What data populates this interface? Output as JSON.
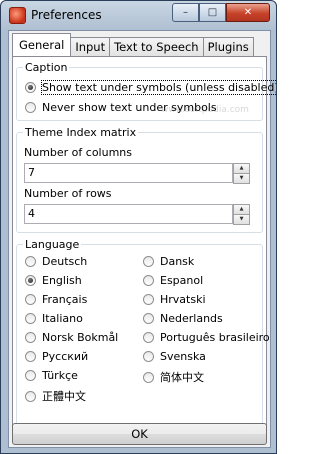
{
  "window": {
    "title": "Preferences"
  },
  "title_buttons": {
    "minimize": "–",
    "maximize": "□",
    "close": "✕"
  },
  "tabs": [
    {
      "label": "General",
      "active": true
    },
    {
      "label": "Input",
      "active": false
    },
    {
      "label": "Text to Speech",
      "active": false
    },
    {
      "label": "Plugins",
      "active": false
    }
  ],
  "caption": {
    "legend": "Caption",
    "options": [
      {
        "label": "Show text under symbols (unless disabled)",
        "selected": true
      },
      {
        "label": "Never show text under symbols",
        "selected": false
      }
    ]
  },
  "matrix": {
    "legend": "Theme Index matrix",
    "columns_label": "Number of columns",
    "columns_value": "7",
    "rows_label": "Number of rows",
    "rows_value": "4"
  },
  "language": {
    "legend": "Language",
    "left": [
      {
        "label": "Deutsch",
        "selected": false
      },
      {
        "label": "English",
        "selected": true
      },
      {
        "label": "Français",
        "selected": false
      },
      {
        "label": "Italiano",
        "selected": false
      },
      {
        "label": "Norsk Bokmål",
        "selected": false
      },
      {
        "label": "Русский",
        "selected": false
      },
      {
        "label": "Türkçe",
        "selected": false
      },
      {
        "label": "正體中文",
        "selected": false
      }
    ],
    "right": [
      {
        "label": "Dansk",
        "selected": false
      },
      {
        "label": "Espanol",
        "selected": false
      },
      {
        "label": "Hrvatski",
        "selected": false
      },
      {
        "label": "Nederlands",
        "selected": false
      },
      {
        "label": "Português brasileiro",
        "selected": false
      },
      {
        "label": "Svenska",
        "selected": false
      },
      {
        "label": "简体中文",
        "selected": false
      }
    ]
  },
  "ok_label": "OK",
  "watermark": "www.softpedia.com"
}
